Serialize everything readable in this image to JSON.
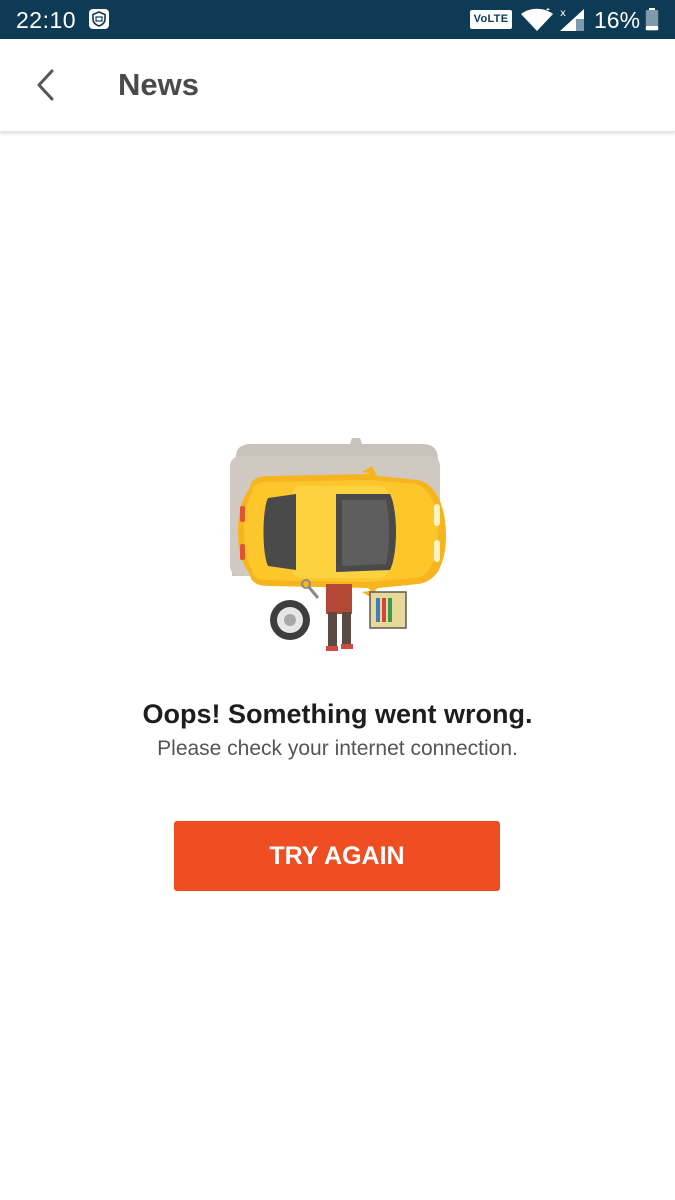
{
  "status_bar": {
    "time": "22:10",
    "network_badge": "VoLTE",
    "battery_percent": "16%",
    "icons": [
      "notification-icon",
      "wifi-icon",
      "signal-icon",
      "battery-icon"
    ],
    "background_color": "#0d3a55"
  },
  "app_bar": {
    "back_icon": "chevron-left-icon",
    "title": "News"
  },
  "error": {
    "illustration": "car-repair-illustration",
    "title": "Oops! Something went wrong.",
    "message": "Please check your internet connection."
  },
  "actions": {
    "retry_label": "TRY AGAIN",
    "retry_color": "#ef4e22"
  }
}
